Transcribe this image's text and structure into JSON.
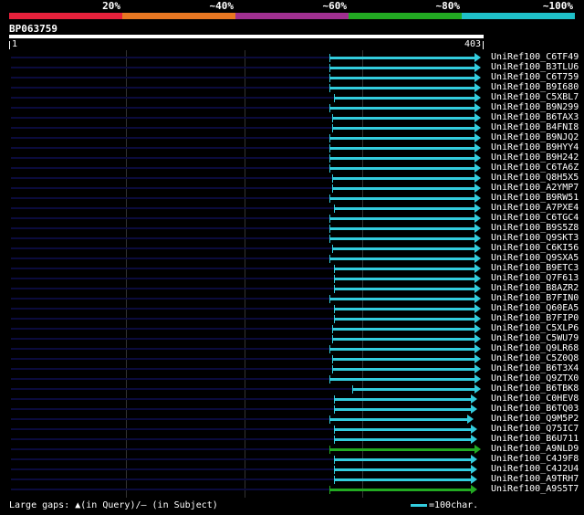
{
  "colors": {
    "background": "#000000",
    "hit": "#33ccdd",
    "hit_green": "#22aa22",
    "gap": "#0b0b3c"
  },
  "scale": {
    "labels": [
      "20%",
      "~40%",
      "~60%",
      "~80%",
      "~100%"
    ],
    "colors": [
      "#e6213b",
      "#e87722",
      "#a03090",
      "#22aa22",
      "#1fc0c8"
    ]
  },
  "query": {
    "id": "BP063759",
    "start": "1",
    "end": "403"
  },
  "hits": [
    {
      "name": "UniRef100_C6TF49",
      "start": 0.679,
      "end": 0.99,
      "color": "hit"
    },
    {
      "name": "UniRef100_B3TLU6",
      "start": 0.679,
      "end": 0.99,
      "color": "hit"
    },
    {
      "name": "UniRef100_C6T759",
      "start": 0.679,
      "end": 0.99,
      "color": "hit"
    },
    {
      "name": "UniRef100_B9I680",
      "start": 0.679,
      "end": 0.99,
      "color": "hit"
    },
    {
      "name": "UniRef100_C5XBL7",
      "start": 0.689,
      "end": 0.99,
      "color": "hit"
    },
    {
      "name": "UniRef100_B9N299",
      "start": 0.679,
      "end": 0.99,
      "color": "hit"
    },
    {
      "name": "UniRef100_B6TAX3",
      "start": 0.684,
      "end": 0.99,
      "color": "hit"
    },
    {
      "name": "UniRef100_B4FNI8",
      "start": 0.684,
      "end": 0.99,
      "color": "hit"
    },
    {
      "name": "UniRef100_B9NJQ2",
      "start": 0.679,
      "end": 0.99,
      "color": "hit"
    },
    {
      "name": "UniRef100_B9HYY4",
      "start": 0.679,
      "end": 0.99,
      "color": "hit"
    },
    {
      "name": "UniRef100_B9H242",
      "start": 0.679,
      "end": 0.99,
      "color": "hit"
    },
    {
      "name": "UniRef100_C6TA6Z",
      "start": 0.679,
      "end": 0.99,
      "color": "hit"
    },
    {
      "name": "UniRef100_Q8H5X5",
      "start": 0.684,
      "end": 0.99,
      "color": "hit"
    },
    {
      "name": "UniRef100_A2YMP7",
      "start": 0.684,
      "end": 0.99,
      "color": "hit"
    },
    {
      "name": "UniRef100_B9RW51",
      "start": 0.679,
      "end": 0.99,
      "color": "hit"
    },
    {
      "name": "UniRef100_A7PXE4",
      "start": 0.689,
      "end": 0.99,
      "color": "hit"
    },
    {
      "name": "UniRef100_C6TGC4",
      "start": 0.679,
      "end": 0.99,
      "color": "hit"
    },
    {
      "name": "UniRef100_B9S5Z8",
      "start": 0.679,
      "end": 0.99,
      "color": "hit"
    },
    {
      "name": "UniRef100_Q9SKT3",
      "start": 0.679,
      "end": 0.99,
      "color": "hit"
    },
    {
      "name": "UniRef100_C6KI56",
      "start": 0.684,
      "end": 0.99,
      "color": "hit"
    },
    {
      "name": "UniRef100_Q9SXA5",
      "start": 0.679,
      "end": 0.99,
      "color": "hit"
    },
    {
      "name": "UniRef100_B9ETC3",
      "start": 0.689,
      "end": 0.99,
      "color": "hit"
    },
    {
      "name": "UniRef100_Q7F613",
      "start": 0.689,
      "end": 0.99,
      "color": "hit"
    },
    {
      "name": "UniRef100_B8AZR2",
      "start": 0.689,
      "end": 0.99,
      "color": "hit"
    },
    {
      "name": "UniRef100_B7FIN0",
      "start": 0.679,
      "end": 0.99,
      "color": "hit"
    },
    {
      "name": "UniRef100_Q60EA5",
      "start": 0.689,
      "end": 0.99,
      "color": "hit"
    },
    {
      "name": "UniRef100_B7FIP0",
      "start": 0.689,
      "end": 0.99,
      "color": "hit"
    },
    {
      "name": "UniRef100_C5XLP6",
      "start": 0.684,
      "end": 0.99,
      "color": "hit"
    },
    {
      "name": "UniRef100_C5WU79",
      "start": 0.684,
      "end": 0.99,
      "color": "hit"
    },
    {
      "name": "UniRef100_Q9LR68",
      "start": 0.679,
      "end": 0.99,
      "color": "hit"
    },
    {
      "name": "UniRef100_C5Z0Q8",
      "start": 0.684,
      "end": 0.99,
      "color": "hit"
    },
    {
      "name": "UniRef100_B6T3X4",
      "start": 0.684,
      "end": 0.99,
      "color": "hit"
    },
    {
      "name": "UniRef100_Q9ZTX0",
      "start": 0.679,
      "end": 0.99,
      "color": "hit"
    },
    {
      "name": "UniRef100_B6TBK8",
      "start": 0.727,
      "end": 0.99,
      "color": "hit"
    },
    {
      "name": "UniRef100_C0HEV8",
      "start": 0.689,
      "end": 0.983,
      "color": "hit"
    },
    {
      "name": "UniRef100_B6TQ03",
      "start": 0.689,
      "end": 0.983,
      "color": "hit"
    },
    {
      "name": "UniRef100_Q9M5P2",
      "start": 0.679,
      "end": 0.975,
      "color": "hit"
    },
    {
      "name": "UniRef100_Q75IC7",
      "start": 0.689,
      "end": 0.983,
      "color": "hit"
    },
    {
      "name": "UniRef100_B6U711",
      "start": 0.689,
      "end": 0.983,
      "color": "hit"
    },
    {
      "name": "UniRef100_A9NLD9",
      "start": 0.679,
      "end": 0.99,
      "color": "hit_green"
    },
    {
      "name": "UniRef100_C4J9F8",
      "start": 0.689,
      "end": 0.983,
      "color": "hit"
    },
    {
      "name": "UniRef100_C4J2U4",
      "start": 0.689,
      "end": 0.983,
      "color": "hit"
    },
    {
      "name": "UniRef100_A9TRH7",
      "start": 0.689,
      "end": 0.983,
      "color": "hit"
    },
    {
      "name": "UniRef100_A9S5T7",
      "start": 0.679,
      "end": 0.983,
      "color": "hit_green"
    }
  ],
  "footer": {
    "gaps_text": "Large gaps: ▲(in Query)/— (in Subject)",
    "legend_text": "=100char."
  }
}
